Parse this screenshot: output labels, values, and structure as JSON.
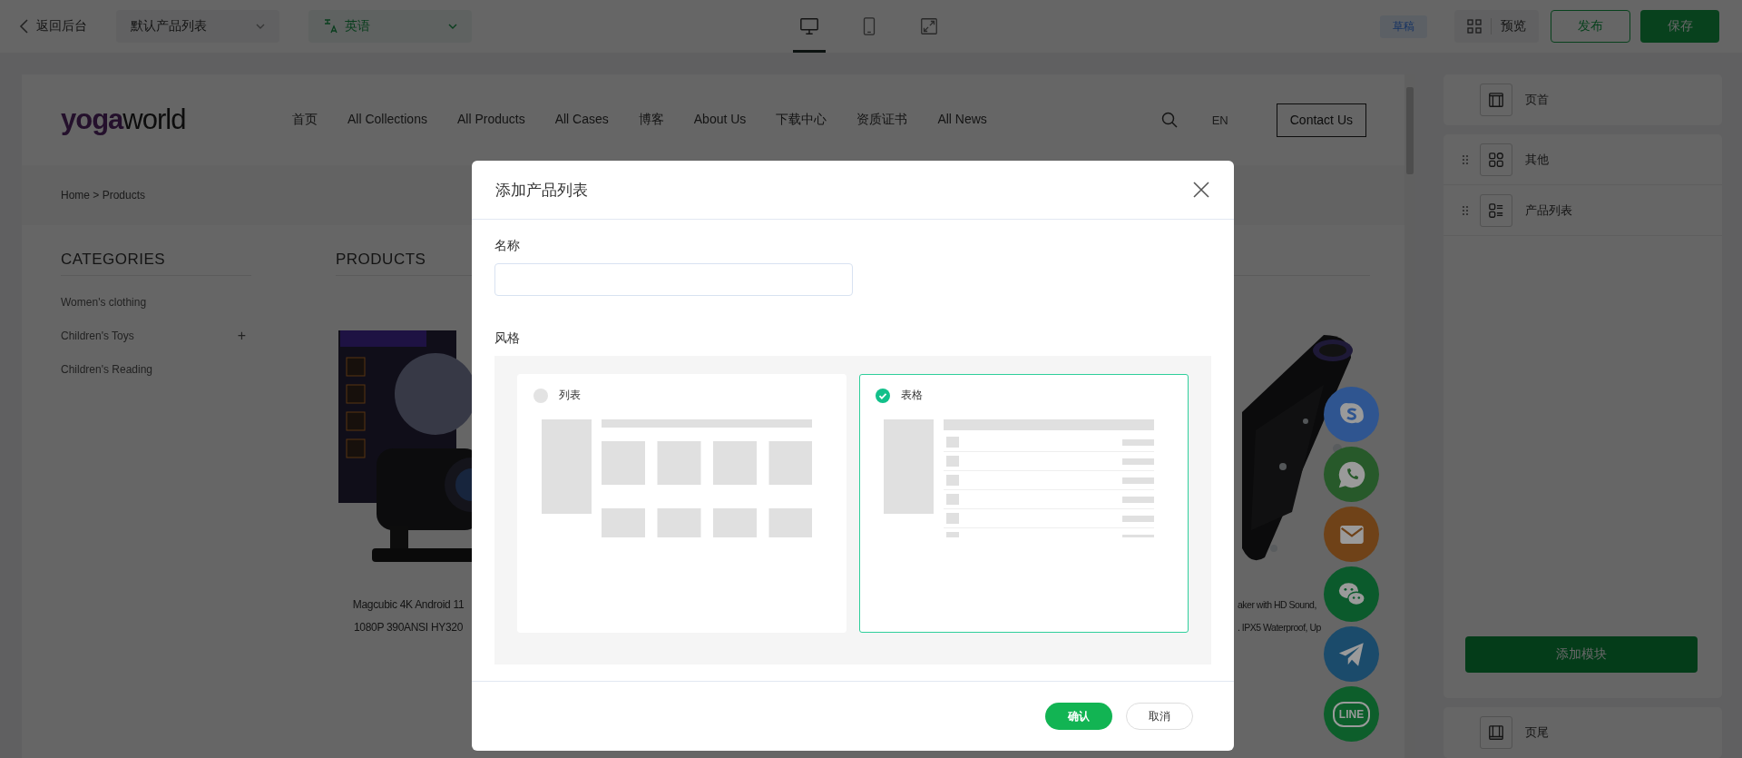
{
  "top_bar": {
    "back": "返回后台",
    "page_select": "默认产品列表",
    "language_select": "英语",
    "device_modes": [
      {
        "kind": "desktop",
        "selected": true
      },
      {
        "kind": "mobile",
        "selected": false
      },
      {
        "kind": "fullscreen",
        "selected": false
      }
    ],
    "status": "草稿",
    "preview": "预览",
    "publish": "发布",
    "save": "保存"
  },
  "site": {
    "logo": {
      "accent": "yoga",
      "rest": "world"
    },
    "nav": [
      "首页",
      "All Collections",
      "All Products",
      "All Cases",
      "博客",
      "About Us",
      "下载中心",
      "资质证书",
      "All News"
    ],
    "language": "EN",
    "contact_button": "Contact Us",
    "breadcrumb": "Home > Products",
    "categories_title": "CATEGORIES",
    "categories": [
      {
        "label": "Women's clothing"
      },
      {
        "label": "Children's Toys",
        "toggle": "+"
      },
      {
        "label": "Children's Reading"
      }
    ],
    "products_title": "PRODUCTS",
    "products": [
      {
        "kind": "projector",
        "title_lines": [
          "Magcubic 4K Android 11",
          "1080P 390ANSI HY320"
        ]
      },
      {
        "kind": "speaker",
        "title_lines": [
          "aker with HD Sound,",
          ". IPX5 Waterproof, Up"
        ]
      }
    ]
  },
  "floating_contacts": [
    {
      "kind": "skype",
      "color": "#2f5590"
    },
    {
      "kind": "whatsapp",
      "color": "#27592a"
    },
    {
      "kind": "email",
      "color": "#6f4218"
    },
    {
      "kind": "wechat",
      "color": "#0b5a2c"
    },
    {
      "kind": "telegram",
      "color": "#1b4b6b"
    },
    {
      "kind": "line",
      "color": "#0d5e2b",
      "label": "LINE"
    }
  ],
  "editor_panel": {
    "header_module": "页首",
    "modules": [
      {
        "kind": "grid",
        "label": "其他"
      },
      {
        "kind": "list",
        "label": "产品列表"
      }
    ],
    "add_button": "添加模块",
    "footer_module": "页尾"
  },
  "dialog": {
    "title": "添加产品列表",
    "name_label": "名称",
    "style_label": "风格",
    "styles": [
      {
        "kind": "list",
        "label": "列表",
        "selected": false
      },
      {
        "kind": "table",
        "label": "表格",
        "selected": true
      }
    ],
    "confirm": "确认",
    "cancel": "取消"
  }
}
